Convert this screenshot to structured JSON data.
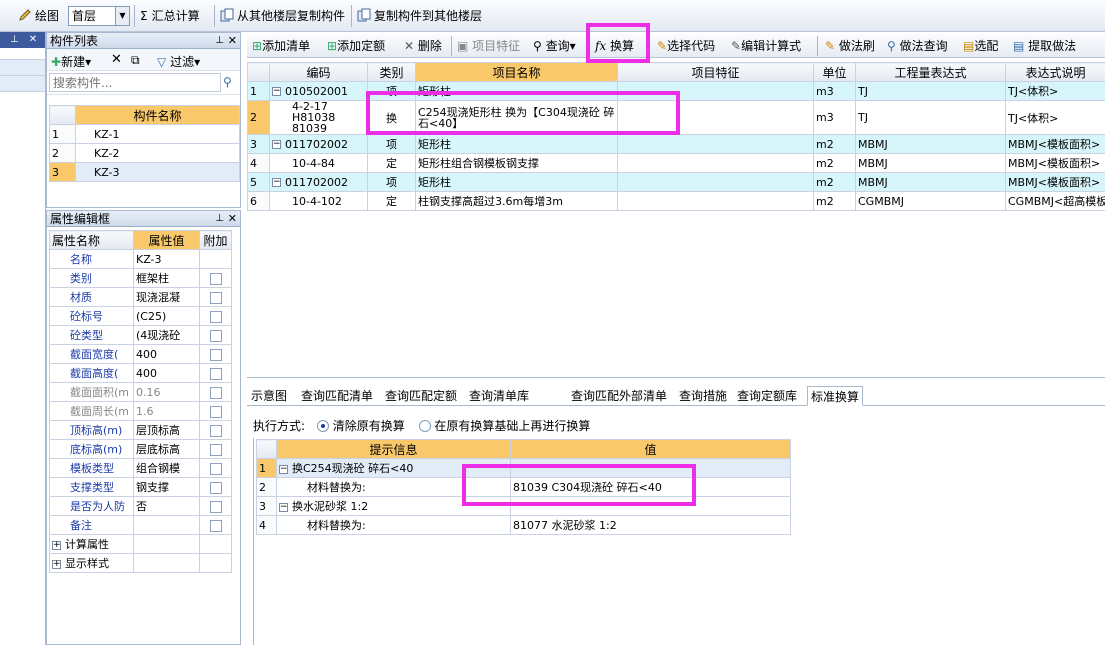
{
  "toolbar": {
    "draw_label": "绘图",
    "floor_value": "首层",
    "sum_label": "汇总计算",
    "copy_from_label": "从其他楼层复制构件",
    "copy_to_label": "复制构件到其他楼层"
  },
  "component_panel": {
    "title": "构件列表",
    "new_label": "新建",
    "filter_label": "过滤",
    "search_placeholder": "搜索构件...",
    "header": "构件名称",
    "rows": [
      {
        "no": "1",
        "name": "KZ-1"
      },
      {
        "no": "2",
        "name": "KZ-2"
      },
      {
        "no": "3",
        "name": "KZ-3"
      }
    ]
  },
  "props_panel": {
    "title": "属性编辑框",
    "headers": [
      "属性名称",
      "属性值",
      "附加"
    ],
    "rows": [
      {
        "name": "名称",
        "value": "KZ-3"
      },
      {
        "name": "类别",
        "value": "框架柱"
      },
      {
        "name": "材质",
        "value": "现浇混凝"
      },
      {
        "name": "砼标号",
        "value": "(C25)"
      },
      {
        "name": "砼类型",
        "value": "(4现浇砼"
      },
      {
        "name": "截面宽度(",
        "value": "400"
      },
      {
        "name": "截面高度(",
        "value": "400"
      },
      {
        "name": "截面面积(m",
        "value": "0.16"
      },
      {
        "name": "截面周长(m",
        "value": "1.6"
      },
      {
        "name": "顶标高(m)",
        "value": "层顶标高"
      },
      {
        "name": "底标高(m)",
        "value": "层底标高"
      },
      {
        "name": "模板类型",
        "value": "组合钢模"
      },
      {
        "name": "支撑类型",
        "value": "钢支撑"
      },
      {
        "name": "是否为人防",
        "value": "否"
      },
      {
        "name": "备注",
        "value": ""
      }
    ],
    "group1": "计算属性",
    "group2": "显示样式"
  },
  "main_toolbar": {
    "add_list": "添加清单",
    "add_quota": "添加定额",
    "delete": "删除",
    "item_feature": "项目特征",
    "query": "查询",
    "convert": "换算",
    "select_code": "选择代码",
    "edit_formula": "编辑计算式",
    "method_brush": "做法刷",
    "method_query": "做法查询",
    "select_match": "选配",
    "extract": "提取做法"
  },
  "main_grid": {
    "headers": [
      "编码",
      "类别",
      "项目名称",
      "项目特征",
      "单位",
      "工程量表达式",
      "表达式说明"
    ],
    "rows": [
      {
        "no": "1",
        "code": "010502001",
        "type": "项",
        "name": "矩形柱",
        "feature": "",
        "unit": "m3",
        "expr": "TJ",
        "desc": "TJ<体积>"
      },
      {
        "no": "2",
        "code": "4-2-17 H81038 81039",
        "type": "换",
        "name": "C254现浇矩形柱 换为【C304现浇砼 碎石<40】",
        "feature": "",
        "unit": "m3",
        "expr": "TJ",
        "desc": "TJ<体积>"
      },
      {
        "no": "3",
        "code": "011702002",
        "type": "项",
        "name": "矩形柱",
        "feature": "",
        "unit": "m2",
        "expr": "MBMJ",
        "desc": "MBMJ<模板面积>"
      },
      {
        "no": "4",
        "code": "10-4-84",
        "type": "定",
        "name": "矩形柱组合钢模板钢支撑",
        "feature": "",
        "unit": "m2",
        "expr": "MBMJ",
        "desc": "MBMJ<模板面积>"
      },
      {
        "no": "5",
        "code": "011702002",
        "type": "项",
        "name": "矩形柱",
        "feature": "",
        "unit": "m2",
        "expr": "MBMJ",
        "desc": "MBMJ<模板面积>"
      },
      {
        "no": "6",
        "code": "10-4-102",
        "type": "定",
        "name": "柱钢支撑高超过3.6m每增3m",
        "feature": "",
        "unit": "m2",
        "expr": "CGMBMJ",
        "desc": "CGMBMJ<超高模板面"
      }
    ]
  },
  "bottom_tabs": [
    "示意图",
    "查询匹配清单",
    "查询匹配定额",
    "查询清单库",
    "查询匹配外部清单",
    "查询措施",
    "查询定额库",
    "标准换算"
  ],
  "exec": {
    "label": "执行方式:",
    "opt1": "清除原有换算",
    "opt2": "在原有换算基础上再进行换算"
  },
  "conv_grid": {
    "headers": [
      "提示信息",
      "值"
    ],
    "rows": [
      {
        "no": "1",
        "info": "换C254现浇砼 碎石<40",
        "value": ""
      },
      {
        "no": "2",
        "info": "材料替换为:",
        "value": "81039  C304现浇砼 碎石<40"
      },
      {
        "no": "3",
        "info": "换水泥砂浆 1:2",
        "value": ""
      },
      {
        "no": "4",
        "info": "材料替换为:",
        "value": "81077  水泥砂浆 1:2"
      }
    ]
  }
}
